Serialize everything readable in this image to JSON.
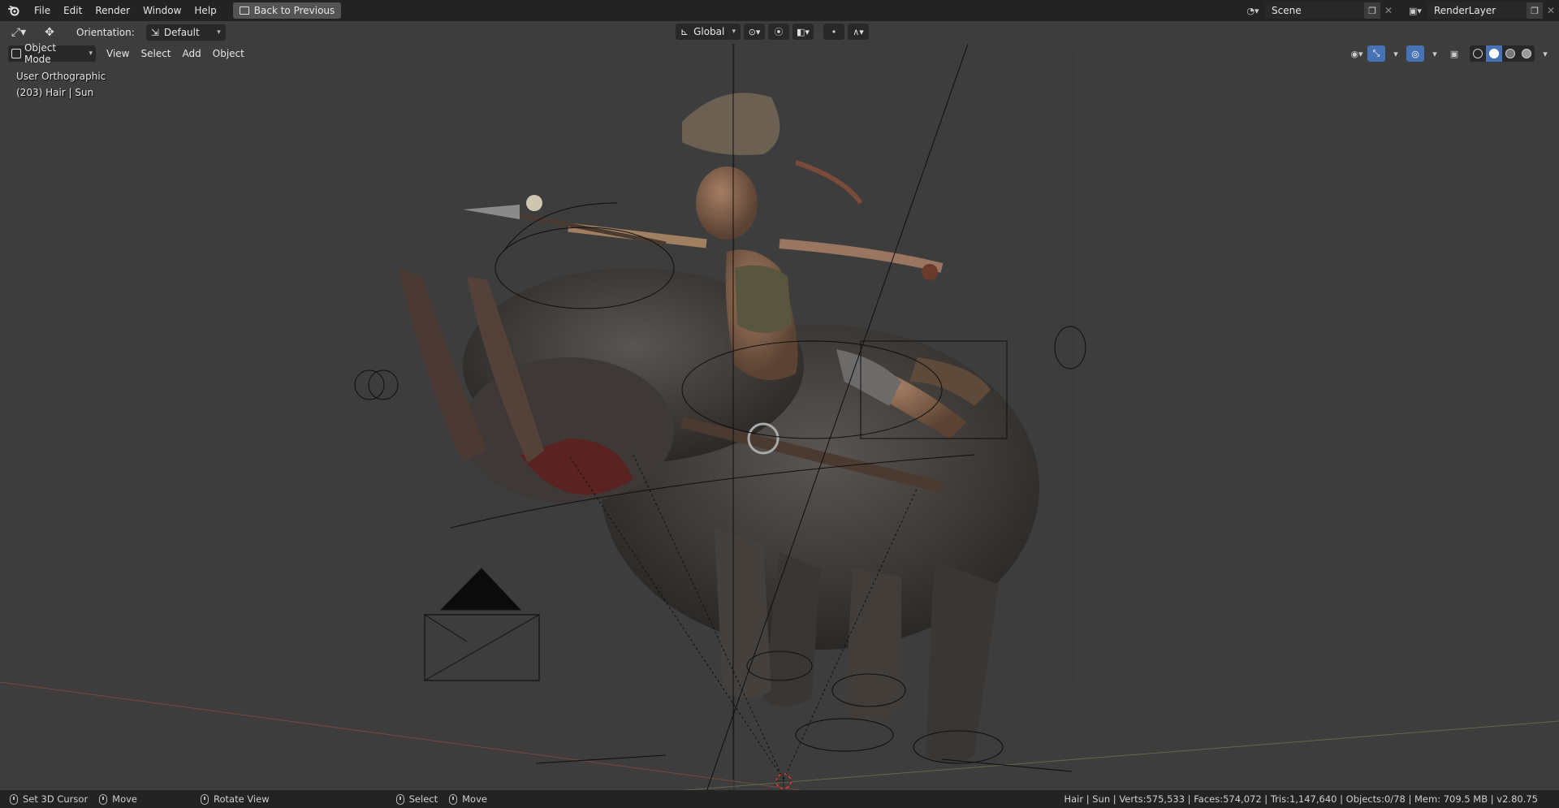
{
  "menu": {
    "file": "File",
    "edit": "Edit",
    "render": "Render",
    "window": "Window",
    "help": "Help",
    "back": "Back to Previous"
  },
  "scene": {
    "name": "Scene"
  },
  "render_layer": {
    "name": "RenderLayer"
  },
  "toolbar": {
    "orientation_label": "Orientation:",
    "orientation_value": "Default",
    "transform_space": "Global"
  },
  "viewport_header": {
    "mode": "Object Mode",
    "view": "View",
    "select": "Select",
    "add": "Add",
    "object": "Object"
  },
  "overlay": {
    "view_name": "User Orthographic",
    "object_info": "(203) Hair | Sun"
  },
  "status": {
    "set_cursor": "Set 3D Cursor",
    "move1": "Move",
    "rotate_view": "Rotate View",
    "select": "Select",
    "move2": "Move",
    "stats": "Hair | Sun | Verts:575,533 | Faces:574,072 | Tris:1,147,640 | Objects:0/78 | Mem: 709.5 MB | v2.80.75"
  },
  "colors": {
    "accent": "#4772b3",
    "bg_viewport": "#3d3d3d",
    "header": "#232323"
  }
}
